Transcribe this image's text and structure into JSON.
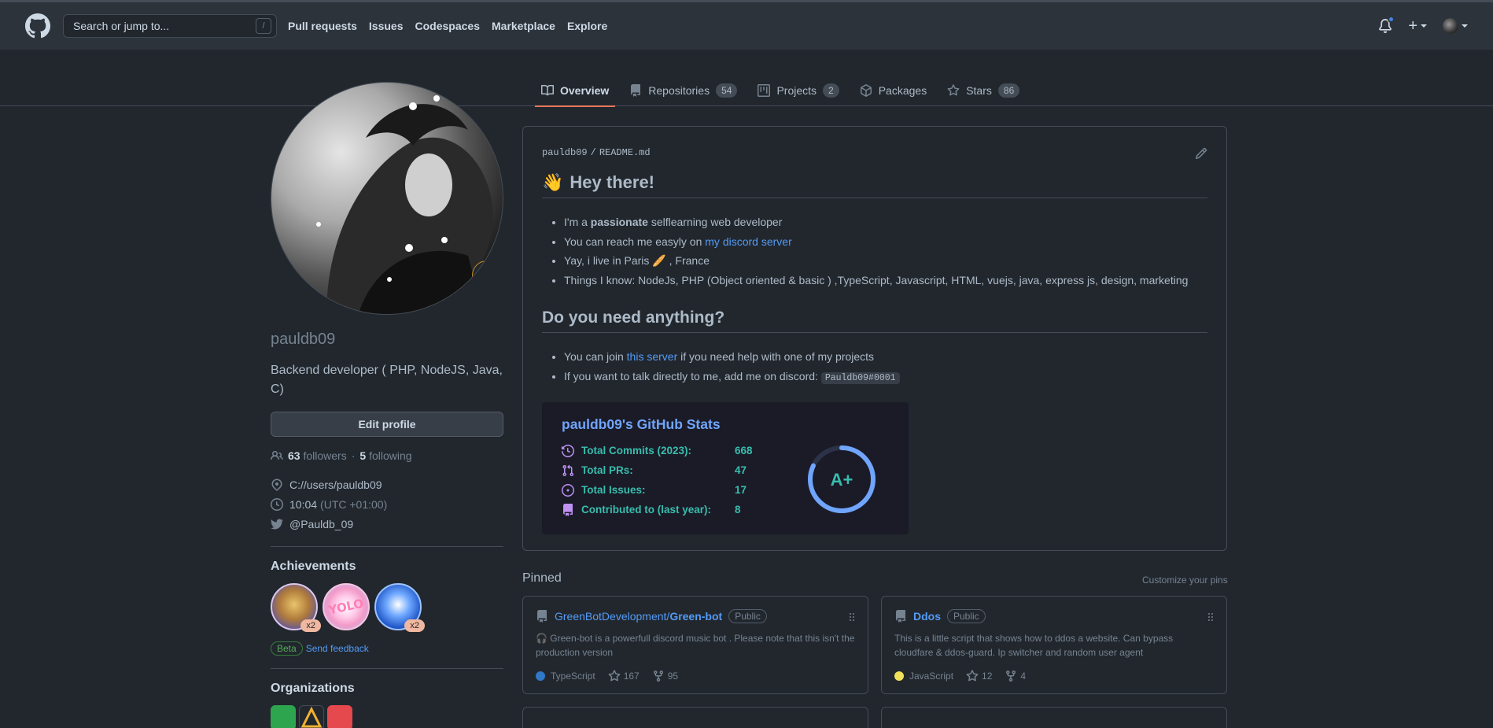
{
  "header": {
    "search_placeholder": "Search or jump to...",
    "search_key": "/",
    "nav": [
      "Pull requests",
      "Issues",
      "Codespaces",
      "Marketplace",
      "Explore"
    ],
    "plus": "+"
  },
  "tabs": [
    {
      "label": "Overview",
      "icon": "book-icon",
      "count": null
    },
    {
      "label": "Repositories",
      "icon": "repo-icon",
      "count": "54"
    },
    {
      "label": "Projects",
      "icon": "project-icon",
      "count": "2"
    },
    {
      "label": "Packages",
      "icon": "package-icon",
      "count": null
    },
    {
      "label": "Stars",
      "icon": "star-icon",
      "count": "86"
    }
  ],
  "profile": {
    "username": "pauldb09",
    "bio": "Backend developer ( PHP, NodeJS, Java, C)",
    "edit_label": "Edit profile",
    "followers": "63",
    "followers_label": "followers",
    "separator": "·",
    "following": "5",
    "following_label": "following",
    "location": "C://users/pauldb09",
    "time": "10:04",
    "timezone": "(UTC +01:00)",
    "twitter": "@Pauldb_09"
  },
  "achievements": {
    "title": "Achievements",
    "items": [
      {
        "name": "quickdraw-achievement",
        "count": "x2"
      },
      {
        "name": "yolo-achievement",
        "count": null
      },
      {
        "name": "pull-shark-achievement",
        "count": "x2"
      }
    ],
    "beta": "Beta",
    "feedback": "Send feedback"
  },
  "organizations": {
    "title": "Organizations"
  },
  "readme": {
    "path_user": "pauldb09",
    "path_sep": "/",
    "path_file": "README.md",
    "heading1_emoji": "👋",
    "heading1": "Hey there!",
    "item1_pre": "I'm a ",
    "item1_bold": "passionate",
    "item1_post": " selflearning web developer",
    "item2_pre": "You can reach me easyly on ",
    "item2_link": "my discord server",
    "item3_pre": "Yay, i live in Paris ",
    "item3_emoji": "🥖",
    "item3_post": " , France",
    "item4": "Things I know: NodeJs, PHP (Object oriented & basic ) ,TypeScript, Javascript, HTML, vuejs, java, express js, design, marketing",
    "heading2": "Do you need anything?",
    "item5_pre": "You can join ",
    "item5_link": "this server",
    "item5_post": " if you need help with one of my projects",
    "item6_pre": "If you want to talk directly to me, add me on discord: ",
    "item6_code": "Pauldb09#0001"
  },
  "stats": {
    "title": "pauldb09's GitHub Stats",
    "rows": [
      {
        "icon": "history-icon",
        "label": "Total Commits (2023):",
        "value": "668"
      },
      {
        "icon": "pull-request-icon",
        "label": "Total PRs:",
        "value": "47"
      },
      {
        "icon": "issue-icon",
        "label": "Total Issues:",
        "value": "17"
      },
      {
        "icon": "repo-icon",
        "label": "Contributed to (last year):",
        "value": "8"
      }
    ],
    "rank": "A+",
    "rank_progress": 0.82,
    "colors": {
      "title": "#70a5fd",
      "text": "#38bdae",
      "icon": "#bf91f3",
      "bg": "#1a1b27"
    }
  },
  "pinned": {
    "title": "Pinned",
    "customize": "Customize your pins",
    "repos": [
      {
        "owner": "GreenBotDevelopment/",
        "name": "Green-bot",
        "visibility": "Public",
        "desc_emoji": "🎧",
        "desc": " Green-bot is a powerfull discord music bot . Please note that this isn't the production version",
        "lang": "TypeScript",
        "lang_color": "#3178c6",
        "stars": "167",
        "forks": "95"
      },
      {
        "owner": "",
        "name": "Ddos",
        "visibility": "Public",
        "desc_emoji": "",
        "desc": "This is a little script that shows how to ddos a website. Can bypass cloudfare & ddos-guard. Ip switcher and random user agent",
        "lang": "JavaScript",
        "lang_color": "#f1e05a",
        "stars": "12",
        "forks": "4"
      }
    ]
  }
}
